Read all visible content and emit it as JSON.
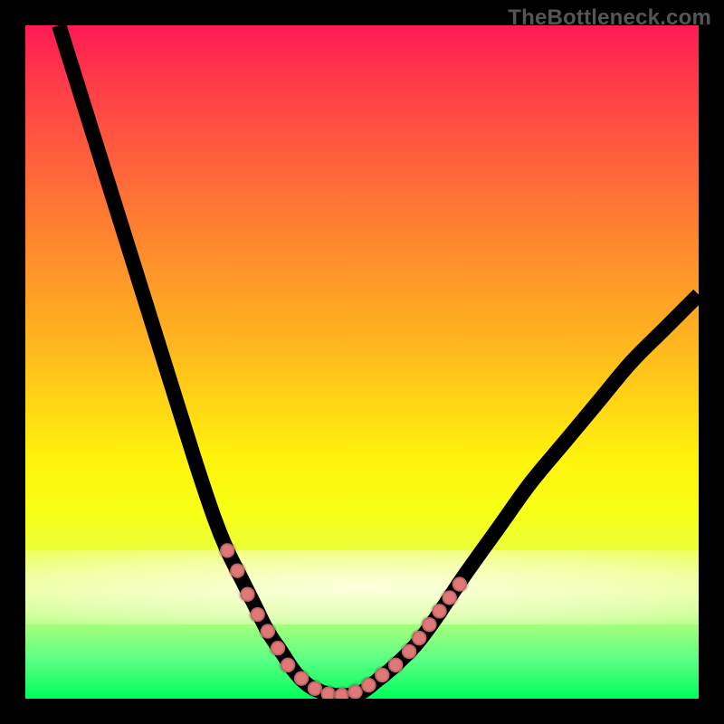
{
  "watermark": "TheBottleneck.com",
  "chart_data": {
    "type": "line",
    "title": "",
    "xlabel": "",
    "ylabel": "",
    "xlim": [
      0,
      100
    ],
    "ylim": [
      0,
      100
    ],
    "series": [
      {
        "name": "bottleneck-curve",
        "x": [
          5,
          10,
          15,
          20,
          25,
          28,
          30,
          32,
          34,
          36,
          38,
          40,
          42,
          44,
          46,
          48,
          50,
          52,
          55,
          58,
          61,
          65,
          70,
          75,
          80,
          85,
          90,
          95,
          100
        ],
        "values": [
          100,
          84,
          68,
          52,
          36,
          27,
          22,
          18,
          14,
          10,
          7,
          4,
          2,
          1,
          0.5,
          0.5,
          1,
          2.5,
          5,
          8,
          12,
          18,
          25,
          32,
          38,
          44,
          50,
          55,
          60
        ]
      }
    ],
    "markers": {
      "name": "highlight-points",
      "points": [
        {
          "x": 30,
          "y": 22
        },
        {
          "x": 31.5,
          "y": 19
        },
        {
          "x": 33,
          "y": 15.5
        },
        {
          "x": 34.5,
          "y": 12.5
        },
        {
          "x": 36,
          "y": 10
        },
        {
          "x": 37.5,
          "y": 7.5
        },
        {
          "x": 39,
          "y": 5
        },
        {
          "x": 41,
          "y": 3
        },
        {
          "x": 43,
          "y": 1.5
        },
        {
          "x": 45,
          "y": 0.7
        },
        {
          "x": 47,
          "y": 0.5
        },
        {
          "x": 49,
          "y": 1
        },
        {
          "x": 51,
          "y": 2
        },
        {
          "x": 53,
          "y": 3.5
        },
        {
          "x": 55,
          "y": 5
        },
        {
          "x": 57,
          "y": 7
        },
        {
          "x": 58.5,
          "y": 9
        },
        {
          "x": 60,
          "y": 11
        },
        {
          "x": 61.5,
          "y": 13
        },
        {
          "x": 63,
          "y": 15
        },
        {
          "x": 64.5,
          "y": 17
        }
      ]
    },
    "gradient": "rainbow-vertical",
    "grid": false
  }
}
